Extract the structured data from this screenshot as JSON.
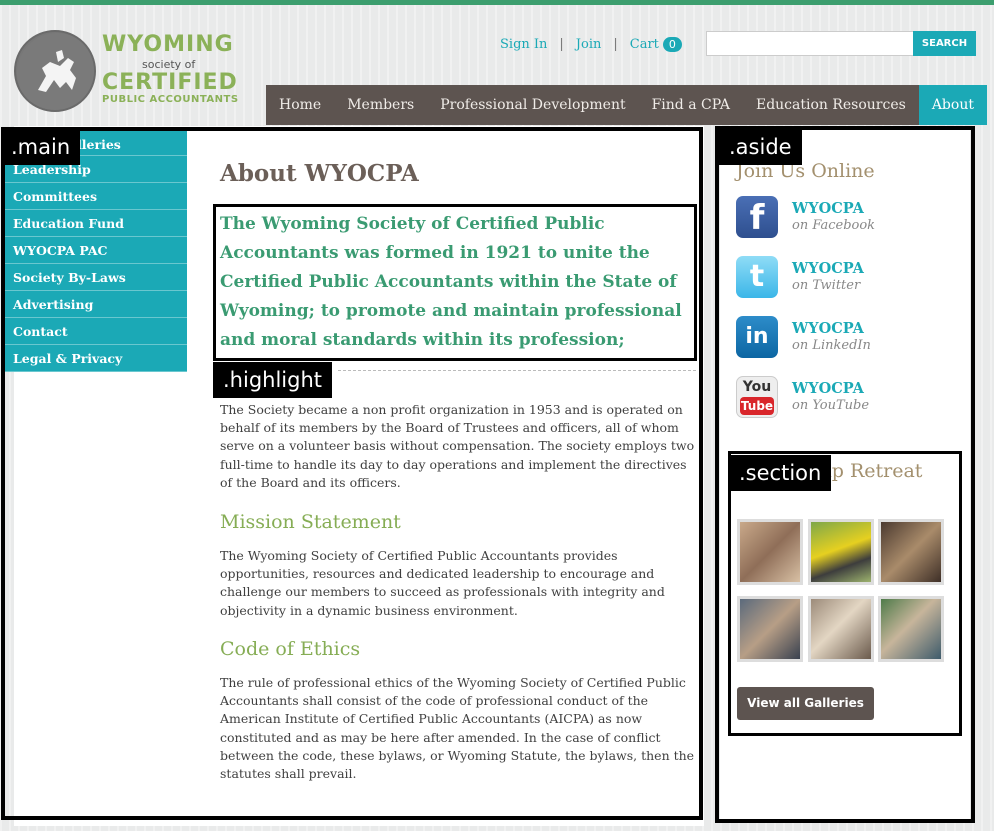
{
  "logo": {
    "line1": "WYOMING",
    "line2": "society of",
    "line3": "CERTIFIED",
    "line4": "PUBLIC ACCOUNTANTS"
  },
  "utility": {
    "sign_in": "Sign In",
    "join": "Join",
    "cart": "Cart",
    "cart_count": "0",
    "search_placeholder": "",
    "search_button": "SEARCH"
  },
  "nav": {
    "items": [
      "Home",
      "Members",
      "Professional Development",
      "Find a CPA",
      "Education Resources",
      "About"
    ],
    "active": "About"
  },
  "sidebar": {
    "items": [
      "Photo Galleries",
      "Leadership",
      "Committees",
      "Education Fund",
      "WYOCPA PAC",
      "Society By-Laws",
      "Advertising",
      "Contact",
      "Legal & Privacy"
    ]
  },
  "labels": {
    "main": ".main",
    "aside": ".aside",
    "highlight": ".highlight",
    "section": ".section"
  },
  "main": {
    "title": "About WYOCPA",
    "highlight": "The Wyoming Society of Certified Public Accountants was formed in 1921 to unite the Certified Public Accountants within the State of Wyoming; to promote and maintain professional and moral standards within its profession;",
    "intro": "The Society became a non profit organization in 1953 and is operated on behalf of its members by the Board of Trustees and officers, all of whom serve on a volunteer basis without compensation. The society employs two full-time to handle its day to day operations and implement the directives of the Board and its officers.",
    "mission_heading": "Mission Statement",
    "mission_text": "The Wyoming Society of Certified Public Accountants provides opportunities, resources and dedicated leadership to encourage and challenge our members to succeed as professionals with integrity and objectivity in a dynamic business environment.",
    "ethics_heading": "Code of Ethics",
    "ethics_text": "The rule of professional ethics of the Wyoming Society of Certified Public Accountants shall consist of the code of professional conduct of the American Institute of Certified Public Accountants (AICPA) as now constituted and as may be here after amended. In the case of conflict between the code, these bylaws, or Wyoming Statute, the bylaws, then the statutes shall prevail."
  },
  "aside": {
    "title": "Join Us Online",
    "social": [
      {
        "name": "WYOCPA",
        "sub": "on Facebook",
        "icon": "facebook-icon"
      },
      {
        "name": "WYOCPA",
        "sub": "on Twitter",
        "icon": "twitter-icon"
      },
      {
        "name": "WYOCPA",
        "sub": "on LinkedIn",
        "icon": "linkedin-icon"
      },
      {
        "name": "WYOCPA",
        "sub": "on YouTube",
        "icon": "youtube-icon"
      }
    ],
    "gallery_title": "Leadership Retreat",
    "view_all": "View all Galleries"
  },
  "colors": {
    "teal": "#1ba9b6",
    "nav_brown": "#5d5450",
    "green": "#86ad55",
    "highlight_green": "#3a9b72"
  }
}
